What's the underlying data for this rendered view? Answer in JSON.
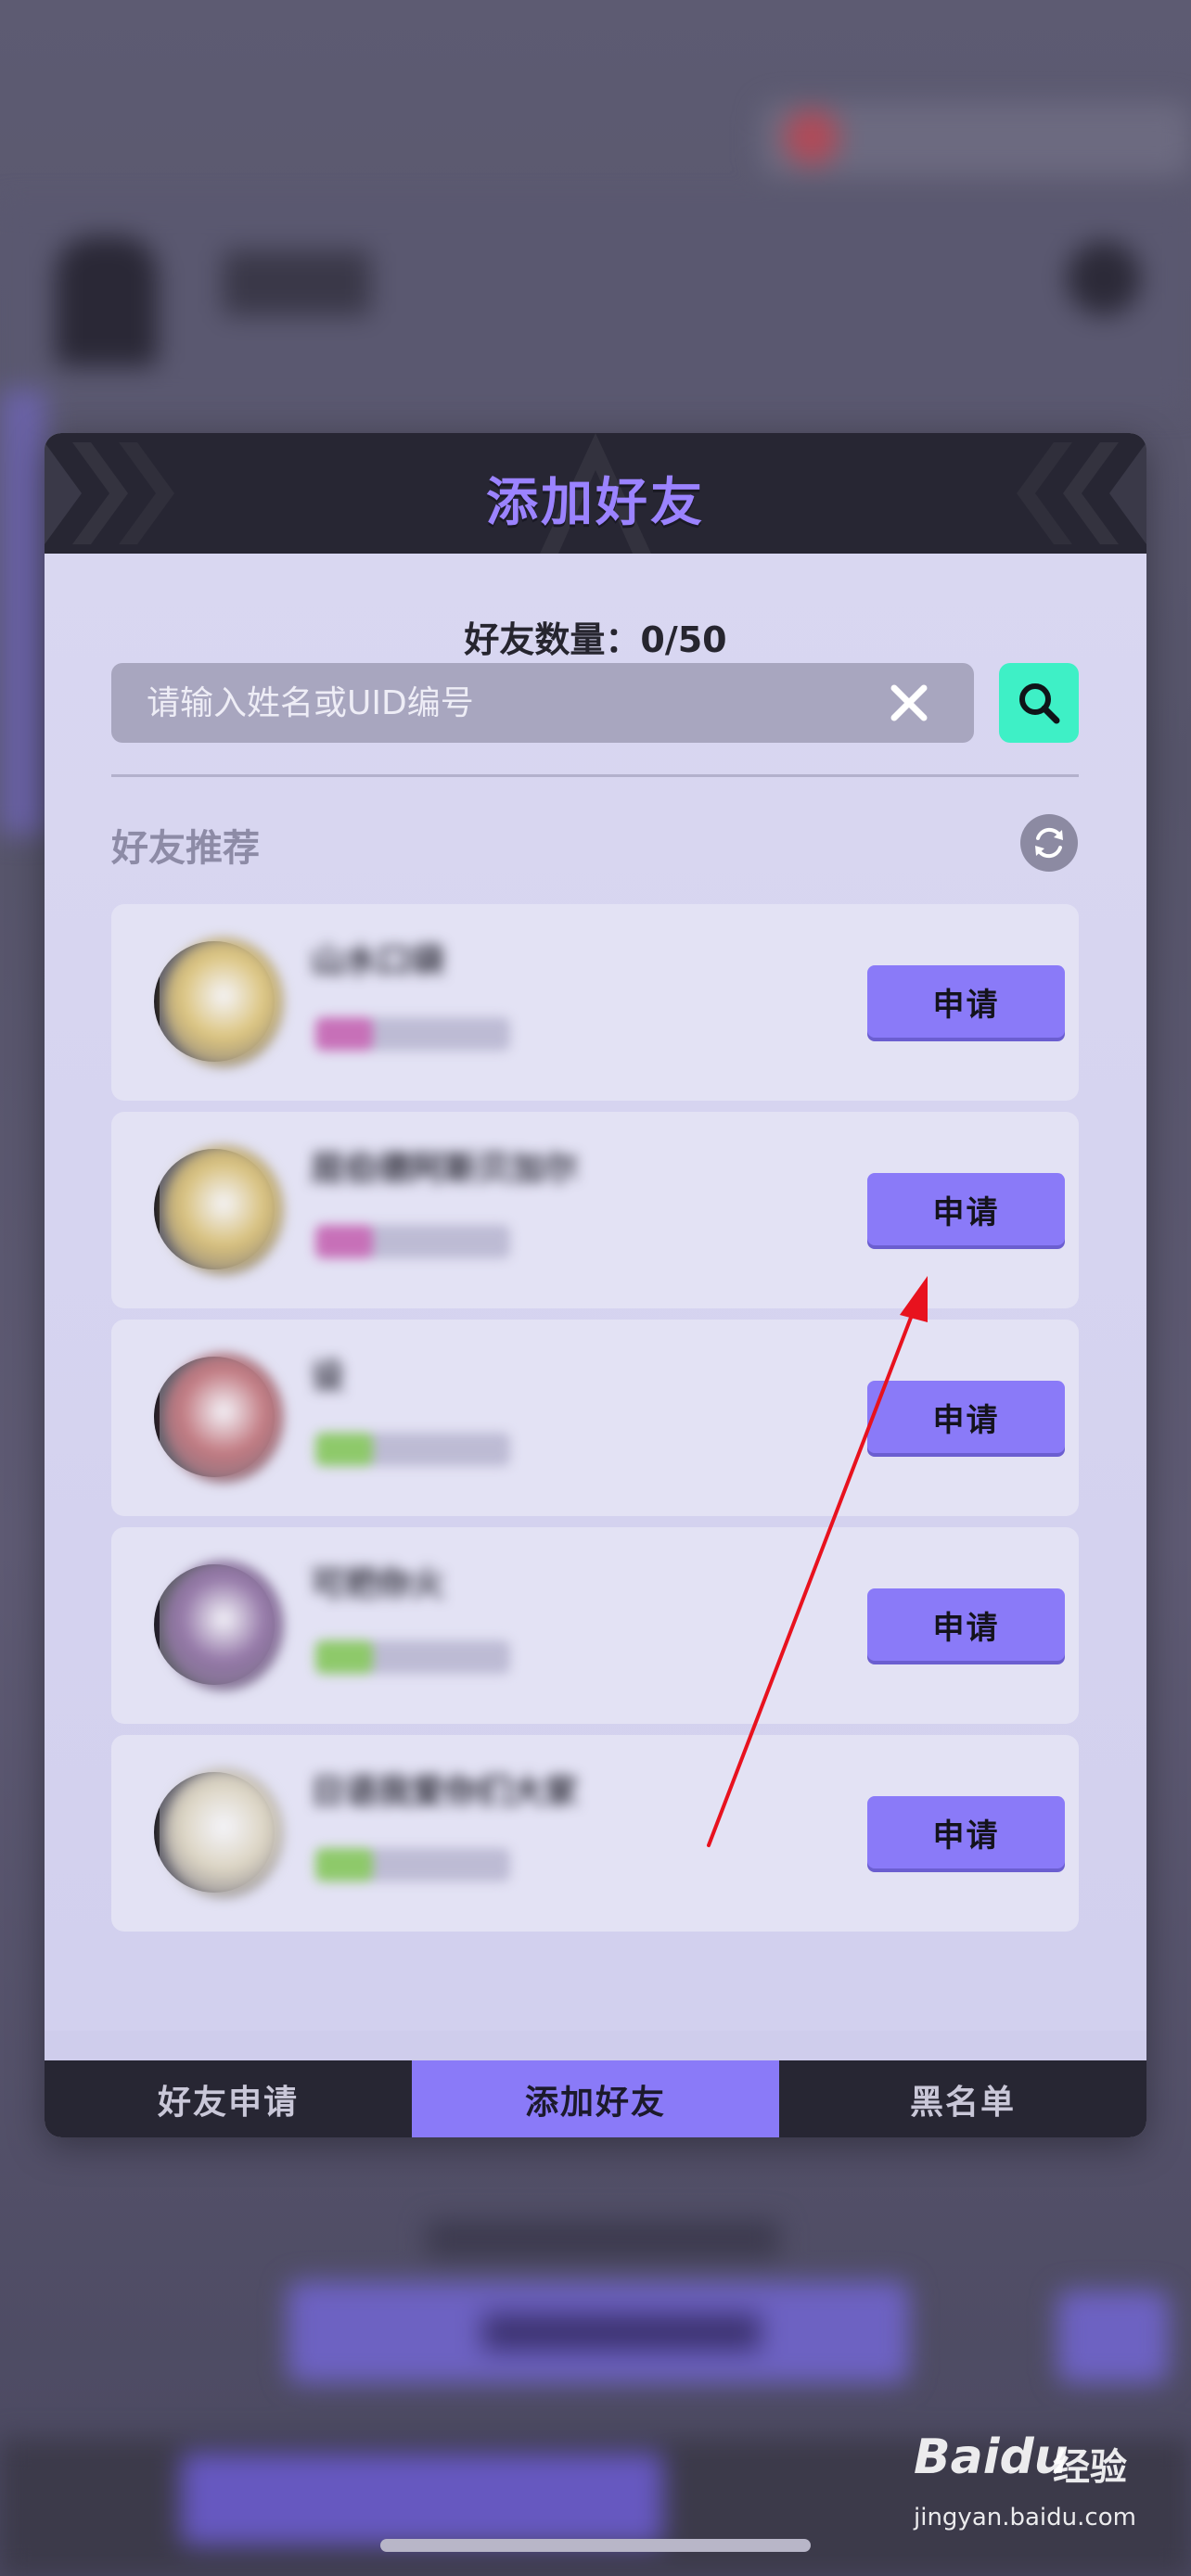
{
  "modal": {
    "title": "添加好友",
    "friend_count_label": "好友数量：0/50",
    "search": {
      "placeholder": "请输入姓名或UID编号",
      "value": ""
    },
    "recommend_title": "好友推荐",
    "friends": [
      {
        "name": "山水口袋",
        "apply_label": "申请",
        "avatar_color": "#d8b440",
        "level_color": "#c770b8"
      },
      {
        "name": "屈伯德阿斯贝加尔",
        "apply_label": "申请",
        "avatar_color": "#d2ae3c",
        "level_color": "#c770b8"
      },
      {
        "name": "设",
        "apply_label": "申请",
        "avatar_color": "#b04244",
        "level_color": "#8ec96a"
      },
      {
        "name": "可把你火",
        "apply_label": "申请",
        "avatar_color": "#6a3e7e",
        "level_color": "#8ec96a"
      },
      {
        "name": "日语我爱你们大家",
        "apply_label": "申请",
        "avatar_color": "#d9ceaa",
        "level_color": "#8ec96a"
      }
    ],
    "tabs": [
      {
        "label": "好友申请",
        "active": false
      },
      {
        "label": "添加好友",
        "active": true
      },
      {
        "label": "黑名单",
        "active": false
      }
    ]
  },
  "annotation": {
    "color": "#e8121e"
  },
  "watermark": {
    "brand": "Baidu",
    "brand_cn": "经验",
    "url": "jingyan.baidu.com"
  },
  "colors": {
    "accent": "#8a7af8",
    "search_button": "#3ef0c6",
    "header_dark": "#272633"
  }
}
